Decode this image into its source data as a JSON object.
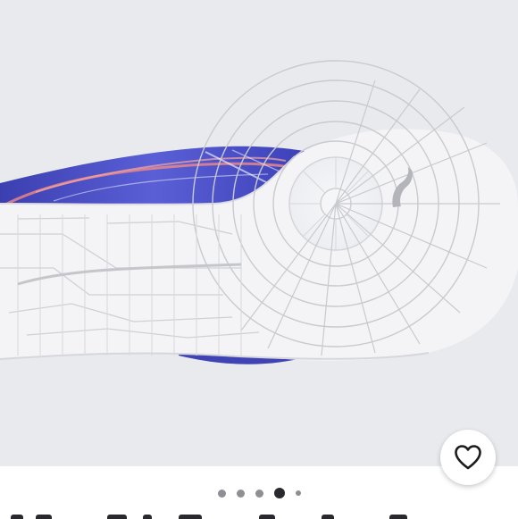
{
  "product_image": {
    "icon": "shoe-outsole-photo",
    "brand_logo": "puma-cat-logo",
    "colors": {
      "background": "#e9eaee",
      "upper": "#4a4fc4",
      "accent": "#f08a86",
      "sole": "#f4f4f6",
      "tread_lines": "#c9cacf"
    }
  },
  "favorite": {
    "icon": "heart-outline-icon",
    "liked": false
  },
  "carousel": {
    "total": 5,
    "active_index": 3
  }
}
